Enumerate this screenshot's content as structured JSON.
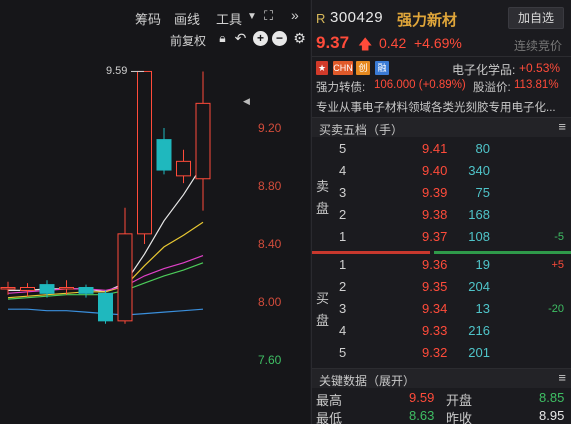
{
  "toolbar": {
    "items": [
      "筹码",
      "画线",
      "工具"
    ],
    "adjust_label": "前复权"
  },
  "chart": {
    "high_label": "9.59",
    "ticks": [
      {
        "label": "9.20",
        "color": "red"
      },
      {
        "label": "8.80",
        "color": "red"
      },
      {
        "label": "8.40",
        "color": "red"
      },
      {
        "label": "8.00",
        "color": "red"
      },
      {
        "label": "7.60",
        "color": "green"
      }
    ]
  },
  "chart_data": {
    "type": "candlestick",
    "ylim": [
      7.5,
      9.7
    ],
    "candles": [
      {
        "o": 8.1,
        "c": 8.09,
        "h": 8.14,
        "l": 8.05,
        "color": "red"
      },
      {
        "o": 8.1,
        "c": 8.08,
        "h": 8.13,
        "l": 8.04,
        "color": "red"
      },
      {
        "o": 8.06,
        "c": 8.12,
        "h": 8.15,
        "l": 8.03,
        "color": "cyan"
      },
      {
        "o": 8.1,
        "c": 8.1,
        "h": 8.15,
        "l": 8.05,
        "color": "red"
      },
      {
        "o": 8.1,
        "c": 8.06,
        "h": 8.12,
        "l": 8.03,
        "color": "cyan"
      },
      {
        "o": 8.06,
        "c": 7.87,
        "h": 8.08,
        "l": 7.85,
        "color": "cyan"
      },
      {
        "o": 7.87,
        "c": 8.47,
        "h": 8.65,
        "l": 7.85,
        "color": "red"
      },
      {
        "o": 8.47,
        "c": 9.59,
        "h": 9.59,
        "l": 8.4,
        "color": "red"
      },
      {
        "o": 9.12,
        "c": 8.91,
        "h": 9.2,
        "l": 8.88,
        "color": "cyan"
      },
      {
        "o": 8.87,
        "c": 8.97,
        "h": 9.05,
        "l": 8.82,
        "color": "red"
      },
      {
        "o": 8.85,
        "c": 9.37,
        "h": 9.59,
        "l": 8.63,
        "color": "red"
      }
    ],
    "ma_lines": [
      {
        "name": "white",
        "color": "#e8e8e8",
        "values": [
          8.08,
          8.08,
          8.09,
          8.09,
          8.09,
          8.07,
          8.13,
          8.33,
          8.56,
          8.74,
          8.95
        ]
      },
      {
        "name": "yellow",
        "color": "#e8c832",
        "values": [
          8.03,
          8.04,
          8.05,
          8.06,
          8.07,
          8.07,
          8.11,
          8.25,
          8.38,
          8.46,
          8.55
        ]
      },
      {
        "name": "magenta",
        "color": "#e040c8",
        "values": [
          8.06,
          8.07,
          8.08,
          8.09,
          8.09,
          8.08,
          8.11,
          8.18,
          8.23,
          8.27,
          8.32
        ]
      },
      {
        "name": "green",
        "color": "#4ccc5a",
        "values": [
          8.02,
          8.03,
          8.04,
          8.05,
          8.05,
          8.05,
          8.08,
          8.13,
          8.18,
          8.22,
          8.27
        ]
      },
      {
        "name": "blue",
        "color": "#3a8fdc",
        "values": [
          7.95,
          7.95,
          7.94,
          7.94,
          7.93,
          7.92,
          7.91,
          7.92,
          7.93,
          7.94,
          7.95
        ]
      }
    ]
  },
  "quote": {
    "badge": "R",
    "code": "300429",
    "name": "强力新材",
    "watch_button": "加自选",
    "price": "9.37",
    "change": "0.42",
    "change_pct": "+4.69%",
    "auction": "连续竞价"
  },
  "tags": {
    "chn": "CHN",
    "chuang": "创",
    "rong": "融",
    "sector": "电子化学品:",
    "sector_pct": "+0.53%"
  },
  "convertible": {
    "label": "强力转债:",
    "value": "106.000 (+0.89%)",
    "premium_label": "股溢价:",
    "premium": "113.81%"
  },
  "description": "专业从事电子材料领域各类光刻胶专用电子化...",
  "order_book": {
    "header": "买卖五档（手）",
    "sell_label": [
      "卖",
      "盘"
    ],
    "buy_label": [
      "买",
      "盘"
    ],
    "sell": [
      {
        "idx": "5",
        "price": "9.41",
        "vol": "80",
        "delta": ""
      },
      {
        "idx": "4",
        "price": "9.40",
        "vol": "340",
        "delta": ""
      },
      {
        "idx": "3",
        "price": "9.39",
        "vol": "75",
        "delta": ""
      },
      {
        "idx": "2",
        "price": "9.38",
        "vol": "168",
        "delta": ""
      },
      {
        "idx": "1",
        "price": "9.37",
        "vol": "108",
        "delta": "-5"
      }
    ],
    "buy": [
      {
        "idx": "1",
        "price": "9.36",
        "vol": "19",
        "delta": "+5"
      },
      {
        "idx": "2",
        "price": "9.35",
        "vol": "204",
        "delta": ""
      },
      {
        "idx": "3",
        "price": "9.34",
        "vol": "13",
        "delta": "-20"
      },
      {
        "idx": "4",
        "price": "9.33",
        "vol": "216",
        "delta": ""
      },
      {
        "idx": "5",
        "price": "9.32",
        "vol": "201",
        "delta": ""
      }
    ]
  },
  "key_data": {
    "header": "关键数据（展开）",
    "high_label": "最高",
    "high": "9.59",
    "open_label": "开盘",
    "open": "8.85",
    "low_label": "最低",
    "low": "8.63",
    "prev_label": "昨收",
    "prev": "8.95"
  },
  "colors": {
    "up": "#ff4b3a",
    "down_cyan": "#1fb8be",
    "vol": "#4fc4c9",
    "green": "#3fbf64"
  }
}
